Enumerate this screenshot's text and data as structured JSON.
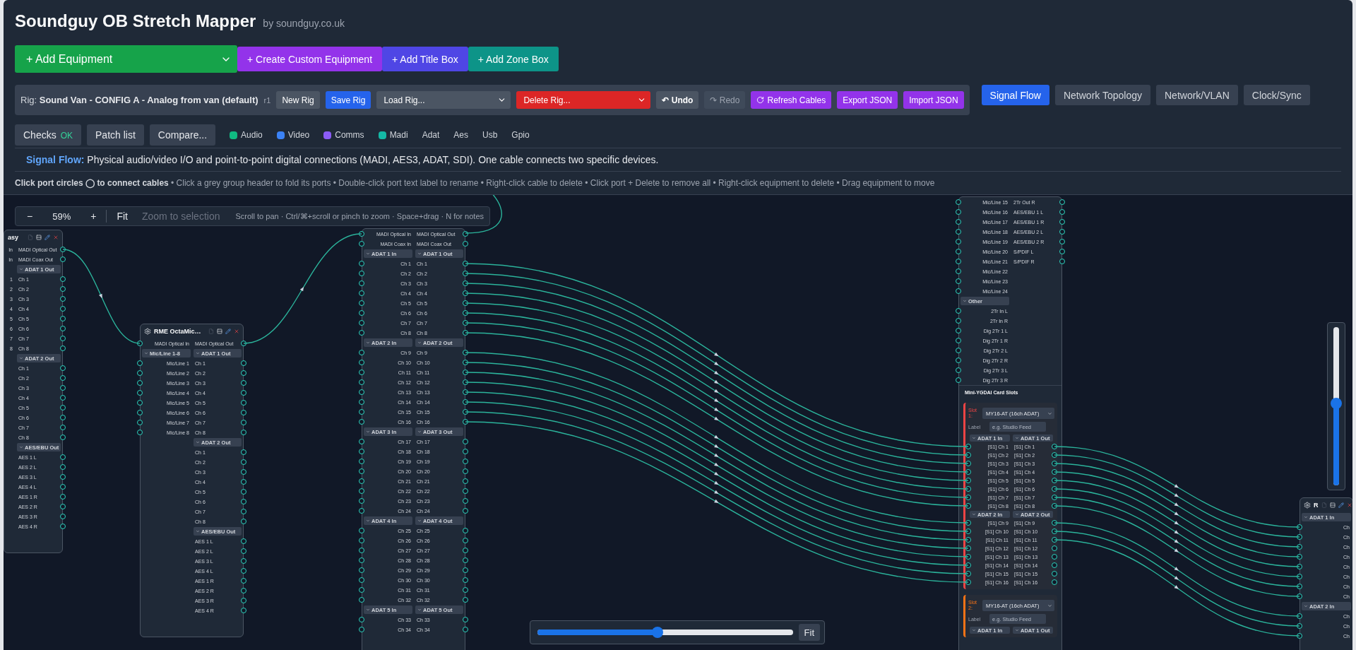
{
  "app": {
    "title": "Soundguy OB Stretch Mapper",
    "byline": "by soundguy.co.uk"
  },
  "add_bar": {
    "equipment_select": "+ Add Equipment",
    "buttons": [
      {
        "label": "+ Create Custom Equipment",
        "kind": "custom"
      },
      {
        "label": "+ Add Title Box",
        "kind": "title"
      },
      {
        "label": "+ Add Zone Box",
        "kind": "zone"
      }
    ]
  },
  "rig_bar": {
    "prefix": "Rig:",
    "name": "Sound Van - CONFIG A - Analog from van (default)",
    "revision": "r1",
    "controls": [
      {
        "label": "New Rig",
        "kind": "plain"
      },
      {
        "label": "Save Rig",
        "kind": "primary"
      },
      {
        "label": "Load Rig...",
        "kind": "select"
      },
      {
        "label": "Delete Rig...",
        "kind": "danger-select"
      },
      {
        "label": "↶ Undo",
        "kind": "history",
        "disabled": false
      },
      {
        "label": "↷ Redo",
        "kind": "history",
        "disabled": true
      },
      {
        "label": "Refresh Cables",
        "kind": "refresh"
      },
      {
        "label": "Export JSON",
        "kind": "accent"
      },
      {
        "label": "Import JSON",
        "kind": "accent"
      }
    ]
  },
  "view_tabs": [
    {
      "label": "Signal Flow",
      "selected": true
    },
    {
      "label": "Network Topology",
      "selected": false
    },
    {
      "label": "Network/VLAN",
      "selected": false
    },
    {
      "label": "Clock/Sync",
      "selected": false
    }
  ],
  "tools": {
    "checks": {
      "label": "Checks",
      "status": "OK"
    },
    "buttons": [
      {
        "label": "Patch list"
      },
      {
        "label": "Compare..."
      }
    ]
  },
  "legend": [
    {
      "label": "Audio",
      "color": "#10b981"
    },
    {
      "label": "Video",
      "color": "#3b82f6"
    },
    {
      "label": "Comms",
      "color": "#8b5cf6"
    },
    {
      "label": "Madi",
      "color": "#14b8a6"
    },
    {
      "label": "Adat"
    },
    {
      "label": "Aes"
    },
    {
      "label": "Usb"
    },
    {
      "label": "Gpio"
    }
  ],
  "mode_info": "**Signal Flow:** Physical audio/video I/O and point-to-point digital connections (MADI, AES3, ADAT, SDI). One cable connects two specific devices.",
  "hint": "**Click port circles ◯ to connect cables** • Click a grey group header to fold its ports • Double-click port text label to rename • Right-click cable to delete • Click port + Delete to remove all • Right-click equipment to delete • Drag equipment to move",
  "canvas": {
    "zoom_bar": {
      "zoom_out": "−",
      "zoom": "59%",
      "zoom_in": "+",
      "fit": "Fit",
      "zoom_to_selection": {
        "label": "Zoom to selection",
        "disabled": true
      },
      "tip": "Scroll to pan · Ctrl/⌘+scroll or pinch to zoom · Space+drag · N for notes"
    },
    "nodes": [
      {
        "title": "asy",
        "sections": [
          {
            "rows": [
              {
                "in": "In",
                "out": "MADI Optical Out"
              },
              {
                "in": "In",
                "out": "MADI Coax Out"
              }
            ]
          },
          {
            "out_header": "ADAT 1 Out",
            "rows": [
              {
                "in": "1",
                "out": "Ch 1"
              },
              {
                "in": "2",
                "out": "Ch 2"
              },
              {
                "in": "3",
                "out": "Ch 3"
              },
              {
                "in": "4",
                "out": "Ch 4"
              },
              {
                "in": "5",
                "out": "Ch 5"
              },
              {
                "in": "6",
                "out": "Ch 6"
              },
              {
                "in": "7",
                "out": "Ch 7"
              },
              {
                "in": "8",
                "out": "Ch 8"
              }
            ]
          },
          {
            "out_header": "ADAT 2 Out",
            "rows": [
              {
                "out": "Ch 1"
              },
              {
                "out": "Ch 2"
              },
              {
                "out": "Ch 3"
              },
              {
                "out": "Ch 4"
              },
              {
                "out": "Ch 5"
              },
              {
                "out": "Ch 6"
              },
              {
                "out": "Ch 7"
              },
              {
                "out": "Ch 8"
              }
            ]
          },
          {
            "out_header": "AES/EBU Out",
            "rows": [
              {
                "out": "AES 1 L"
              },
              {
                "out": "AES 2 L"
              },
              {
                "out": "AES 3 L"
              },
              {
                "out": "AES 4 L"
              },
              {
                "out": "AES 1 R"
              },
              {
                "out": "AES 2 R"
              },
              {
                "out": "AES 3 R"
              },
              {
                "out": "AES 4 R"
              }
            ]
          }
        ]
      },
      {
        "title": "RME OctaMic…",
        "sections": [
          {
            "rows": [
              {
                "in": "MADI Optical In",
                "out": "MADI Optical Out"
              }
            ]
          },
          {
            "in_header": "Mic/Line 1-8",
            "out_header": "ADAT 1 Out",
            "rows": [
              {
                "in": "Mic/Line 1",
                "out": "Ch 1"
              },
              {
                "in": "Mic/Line 2",
                "out": "Ch 2"
              },
              {
                "in": "Mic/Line 3",
                "out": "Ch 3"
              },
              {
                "in": "Mic/Line 4",
                "out": "Ch 4"
              },
              {
                "in": "Mic/Line 5",
                "out": "Ch 5"
              },
              {
                "in": "Mic/Line 6",
                "out": "Ch 6"
              },
              {
                "in": "Mic/Line 7",
                "out": "Ch 7"
              },
              {
                "in": "Mic/Line 8",
                "out": "Ch 8"
              }
            ]
          },
          {
            "out_header": "ADAT 2 Out",
            "rows": [
              {
                "out": "Ch 1"
              },
              {
                "out": "Ch 2"
              },
              {
                "out": "Ch 3"
              },
              {
                "out": "Ch 4"
              },
              {
                "out": "Ch 5"
              },
              {
                "out": "Ch 6"
              },
              {
                "out": "Ch 7"
              },
              {
                "out": "Ch 8"
              }
            ]
          },
          {
            "out_header": "AES/EBU Out",
            "rows": [
              {
                "out": "AES 1 L"
              },
              {
                "out": "AES 2 L"
              },
              {
                "out": "AES 3 L"
              },
              {
                "out": "AES 4 L"
              },
              {
                "out": "AES 1 R"
              },
              {
                "out": "AES 2 R"
              },
              {
                "out": "AES 3 R"
              },
              {
                "out": "AES 4 R"
              }
            ]
          }
        ]
      },
      {
        "sections": [
          {
            "rows": [
              {
                "in": "MADI Optical In",
                "out": "MADI Optical Out"
              },
              {
                "in": "MADI Coax In",
                "out": "MADI Coax Out"
              }
            ]
          },
          {
            "in_header": "ADAT 1 In",
            "out_header": "ADAT 1 Out",
            "rows": [
              {
                "in": "Ch 1",
                "out": "Ch 1"
              },
              {
                "in": "Ch 2",
                "out": "Ch 2"
              },
              {
                "in": "Ch 3",
                "out": "Ch 3"
              },
              {
                "in": "Ch 4",
                "out": "Ch 4"
              },
              {
                "in": "Ch 5",
                "out": "Ch 5"
              },
              {
                "in": "Ch 6",
                "out": "Ch 6"
              },
              {
                "in": "Ch 7",
                "out": "Ch 7"
              },
              {
                "in": "Ch 8",
                "out": "Ch 8"
              }
            ]
          },
          {
            "in_header": "ADAT 2 In",
            "out_header": "ADAT 2 Out",
            "rows": [
              {
                "in": "Ch 9",
                "out": "Ch 9"
              },
              {
                "in": "Ch 10",
                "out": "Ch 10"
              },
              {
                "in": "Ch 11",
                "out": "Ch 11"
              },
              {
                "in": "Ch 12",
                "out": "Ch 12"
              },
              {
                "in": "Ch 13",
                "out": "Ch 13"
              },
              {
                "in": "Ch 14",
                "out": "Ch 14"
              },
              {
                "in": "Ch 15",
                "out": "Ch 15"
              },
              {
                "in": "Ch 16",
                "out": "Ch 16"
              }
            ]
          },
          {
            "in_header": "ADAT 3 In",
            "out_header": "ADAT 3 Out",
            "rows": [
              {
                "in": "Ch 17",
                "out": "Ch 17"
              },
              {
                "in": "Ch 18",
                "out": "Ch 18"
              },
              {
                "in": "Ch 19",
                "out": "Ch 19"
              },
              {
                "in": "Ch 20",
                "out": "Ch 20"
              },
              {
                "in": "Ch 21",
                "out": "Ch 21"
              },
              {
                "in": "Ch 22",
                "out": "Ch 22"
              },
              {
                "in": "Ch 23",
                "out": "Ch 23"
              },
              {
                "in": "Ch 24",
                "out": "Ch 24"
              }
            ]
          },
          {
            "in_header": "ADAT 4 In",
            "out_header": "ADAT 4 Out",
            "rows": [
              {
                "in": "Ch 25",
                "out": "Ch 25"
              },
              {
                "in": "Ch 26",
                "out": "Ch 26"
              },
              {
                "in": "Ch 27",
                "out": "Ch 27"
              },
              {
                "in": "Ch 28",
                "out": "Ch 28"
              },
              {
                "in": "Ch 29",
                "out": "Ch 29"
              },
              {
                "in": "Ch 30",
                "out": "Ch 30"
              },
              {
                "in": "Ch 31",
                "out": "Ch 31"
              },
              {
                "in": "Ch 32",
                "out": "Ch 32"
              }
            ]
          },
          {
            "in_header": "ADAT 5 In",
            "out_header": "ADAT 5 Out",
            "rows": [
              {
                "in": "Ch 33",
                "out": "Ch 33"
              },
              {
                "in": "Ch 34",
                "out": "Ch 34"
              }
            ]
          }
        ]
      },
      {
        "sections": [
          {
            "rows": [
              {
                "in": "Mic/Line 15",
                "out": "2Tr Out R"
              },
              {
                "in": "Mic/Line 16",
                "out": "AES/EBU 1 L"
              },
              {
                "in": "Mic/Line 17",
                "out": "AES/EBU 1 R"
              },
              {
                "in": "Mic/Line 18",
                "out": "AES/EBU 2 L"
              },
              {
                "in": "Mic/Line 19",
                "out": "AES/EBU 2 R"
              },
              {
                "in": "Mic/Line 20",
                "out": "S/PDIF L"
              },
              {
                "in": "Mic/Line 21",
                "out": "S/PDIF R"
              },
              {
                "in": "Mic/Line 22"
              },
              {
                "in": "Mic/Line 23"
              },
              {
                "in": "Mic/Line 24"
              }
            ]
          },
          {
            "in_header": "Other",
            "rows": [
              {
                "in": "2Tr In L"
              },
              {
                "in": "2Tr In R"
              },
              {
                "in": "Dig 2Tr 1 L"
              },
              {
                "in": "Dig 2Tr 1 R"
              },
              {
                "in": "Dig 2Tr 2 L"
              },
              {
                "in": "Dig 2Tr 2 R"
              },
              {
                "in": "Dig 2Tr 3 L"
              },
              {
                "in": "Dig 2Tr 3 R"
              }
            ]
          }
        ],
        "card_slots": {
          "title": "Mini-YGDAI Card Slots",
          "slots": [
            {
              "label": "Slot 1:",
              "color": "#ef4444",
              "card": "MY16-AT (16ch ADAT)",
              "field_label": "Label",
              "placeholder": "e.g. Studio Feed",
              "sections": [
                {
                  "in_header": "ADAT 1 In",
                  "out_header": "ADAT 1 Out",
                  "rows": [
                    {
                      "in": "[S1] Ch 1",
                      "out": "[S1] Ch 1"
                    },
                    {
                      "in": "[S1] Ch 2",
                      "out": "[S1] Ch 2"
                    },
                    {
                      "in": "[S1] Ch 3",
                      "out": "[S1] Ch 3"
                    },
                    {
                      "in": "[S1] Ch 4",
                      "out": "[S1] Ch 4"
                    },
                    {
                      "in": "[S1] Ch 5",
                      "out": "[S1] Ch 5"
                    },
                    {
                      "in": "[S1] Ch 6",
                      "out": "[S1] Ch 6"
                    },
                    {
                      "in": "[S1] Ch 7",
                      "out": "[S1] Ch 7"
                    },
                    {
                      "in": "[S1] Ch 8",
                      "out": "[S1] Ch 8"
                    }
                  ]
                },
                {
                  "in_header": "ADAT 2 In",
                  "out_header": "ADAT 2 Out",
                  "rows": [
                    {
                      "in": "[S1] Ch 9",
                      "out": "[S1] Ch 9"
                    },
                    {
                      "in": "[S1] Ch 10",
                      "out": "[S1] Ch 10"
                    },
                    {
                      "in": "[S1] Ch 11",
                      "out": "[S1] Ch 11"
                    },
                    {
                      "in": "[S1] Ch 12",
                      "out": "[S1] Ch 12"
                    },
                    {
                      "in": "[S1] Ch 13",
                      "out": "[S1] Ch 13"
                    },
                    {
                      "in": "[S1] Ch 14",
                      "out": "[S1] Ch 14"
                    },
                    {
                      "in": "[S1] Ch 15",
                      "out": "[S1] Ch 15"
                    },
                    {
                      "in": "[S1] Ch 16",
                      "out": "[S1] Ch 16"
                    }
                  ]
                }
              ]
            },
            {
              "label": "Slot 2:",
              "color": "#f97316",
              "card": "MY16-AT (16ch ADAT)",
              "field_label": "Label",
              "placeholder": "e.g. Studio Feed",
              "sections": [
                {
                  "in_header": "ADAT 1 In",
                  "out_header": "ADAT 1 Out"
                }
              ]
            }
          ]
        }
      },
      {
        "title": "R",
        "sections": [
          {
            "in_header": "ADAT 1 In",
            "rows": [
              {
                "in": "Ch"
              },
              {
                "in": "Ch"
              },
              {
                "in": "Ch"
              },
              {
                "in": "Ch"
              },
              {
                "in": "Ch"
              },
              {
                "in": "Ch"
              },
              {
                "in": "Ch"
              },
              {
                "in": "Ch"
              }
            ]
          },
          {
            "in_header": "ADAT 2 In",
            "rows": [
              {
                "in": "Ch"
              },
              {
                "in": "Ch"
              },
              {
                "in": "Ch"
              }
            ]
          }
        ]
      }
    ],
    "h_slider": {
      "level": 0.47,
      "button": "Fit"
    },
    "v_slider": {
      "level": 0.52
    }
  }
}
